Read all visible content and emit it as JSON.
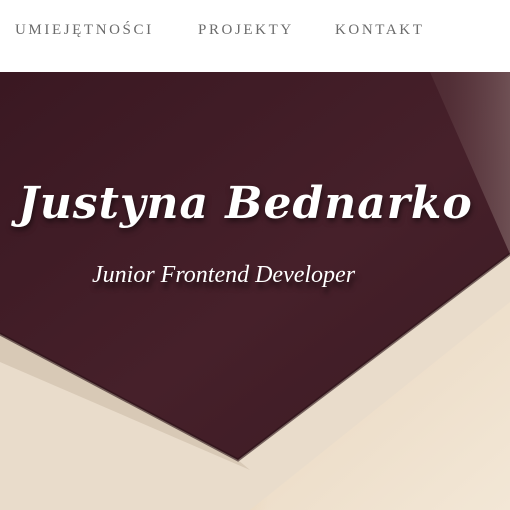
{
  "nav": {
    "items": [
      {
        "label": "UMIEJĘTNOŚCI"
      },
      {
        "label": "PROJEKTY"
      },
      {
        "label": "KONTAKT"
      }
    ]
  },
  "hero": {
    "name": "Justyna Bednarko",
    "subtitle": "Junior Frontend Developer"
  },
  "colors": {
    "nav_text": "#6b6b6b",
    "hero_dark": "#3e1a24",
    "hero_light": "#efe2d0",
    "text_on_hero": "#ffffff"
  }
}
